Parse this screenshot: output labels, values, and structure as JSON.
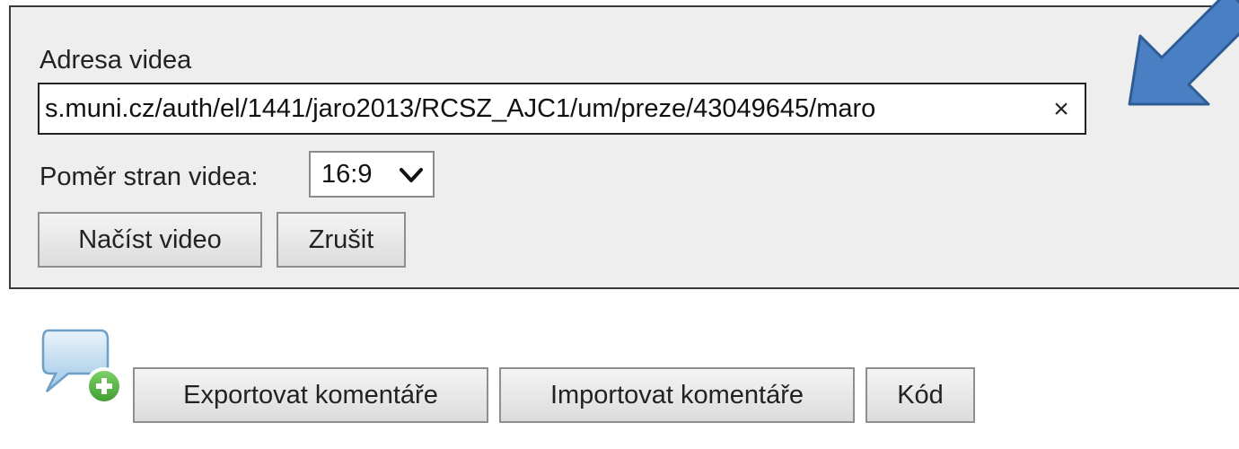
{
  "video_dialog": {
    "address_label": "Adresa videa",
    "address_value": "s.muni.cz/auth/el/1441/jaro2013/RCSZ_AJC1/um/preze/43049645/maro",
    "clear_symbol": "×",
    "aspect_label": "Poměr stran videa:",
    "aspect_selected": "16:9",
    "load_button": "Načíst video",
    "cancel_button": "Zrušit"
  },
  "comments_toolbar": {
    "add_comment_icon": "speech-bubble-plus-icon",
    "export_button": "Exportovat komentáře",
    "import_button": "Importovat komentáře",
    "code_button": "Kód"
  },
  "colors": {
    "panel_background": "#eeeeee",
    "annotation_arrow": "#4a7fc4",
    "add_badge": "#4caf3a"
  }
}
